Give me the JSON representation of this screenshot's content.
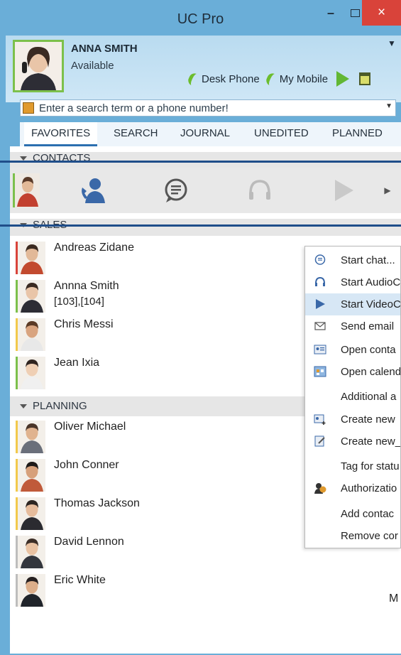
{
  "window": {
    "title": "UC Pro",
    "min": "–",
    "close": "×"
  },
  "profile": {
    "name": "ANNA SMITH",
    "status": "Available",
    "phones": [
      "Desk Phone",
      "My Mobile"
    ]
  },
  "search": {
    "placeholder": "Enter a search term or a phone number!"
  },
  "tabs": [
    "FAVORITES",
    "SEARCH",
    "JOURNAL",
    "UNEDITED",
    "PLANNED"
  ],
  "sections": {
    "contacts": "CONTACTS",
    "sales": "SALES",
    "planning": "PLANNING"
  },
  "contacts": [
    {
      "name": "Andreas Zidane",
      "ext": "",
      "status_color": "#d9433a"
    },
    {
      "name": "Annna Smith",
      "ext": "[103],[104]",
      "status_color": "#7cc04b"
    },
    {
      "name": "Chris Messi",
      "ext": "",
      "status_color": "#f2c94c"
    },
    {
      "name": "Jean Ixia",
      "ext": "",
      "status_color": "#7cc04b"
    },
    {
      "name": "Oliver Michael",
      "ext": "",
      "status_color": "#f2c94c"
    },
    {
      "name": "John Conner",
      "ext": "",
      "status_color": "#f2c94c"
    },
    {
      "name": "Thomas Jackson",
      "ext": "",
      "status_color": "#f2c94c"
    },
    {
      "name": "David Lennon",
      "ext": "",
      "status_color": "#bdbdbd"
    },
    {
      "name": "Eric White",
      "ext": "",
      "status_color": "#bdbdbd"
    }
  ],
  "context_menu": [
    "Start chat...",
    "Start AudioC",
    "Start VideoC",
    "Send email",
    "Open conta",
    "Open calend",
    "Additional a",
    "Create new",
    "Create new_",
    "Tag for statu",
    "Authorizatio",
    "Add contac",
    "Remove cor"
  ],
  "trailing_text": "M",
  "colors": {
    "titlebar": "#6aaed8",
    "close": "#d9433a",
    "accent": "#2b6fb0",
    "green": "#62b734"
  }
}
